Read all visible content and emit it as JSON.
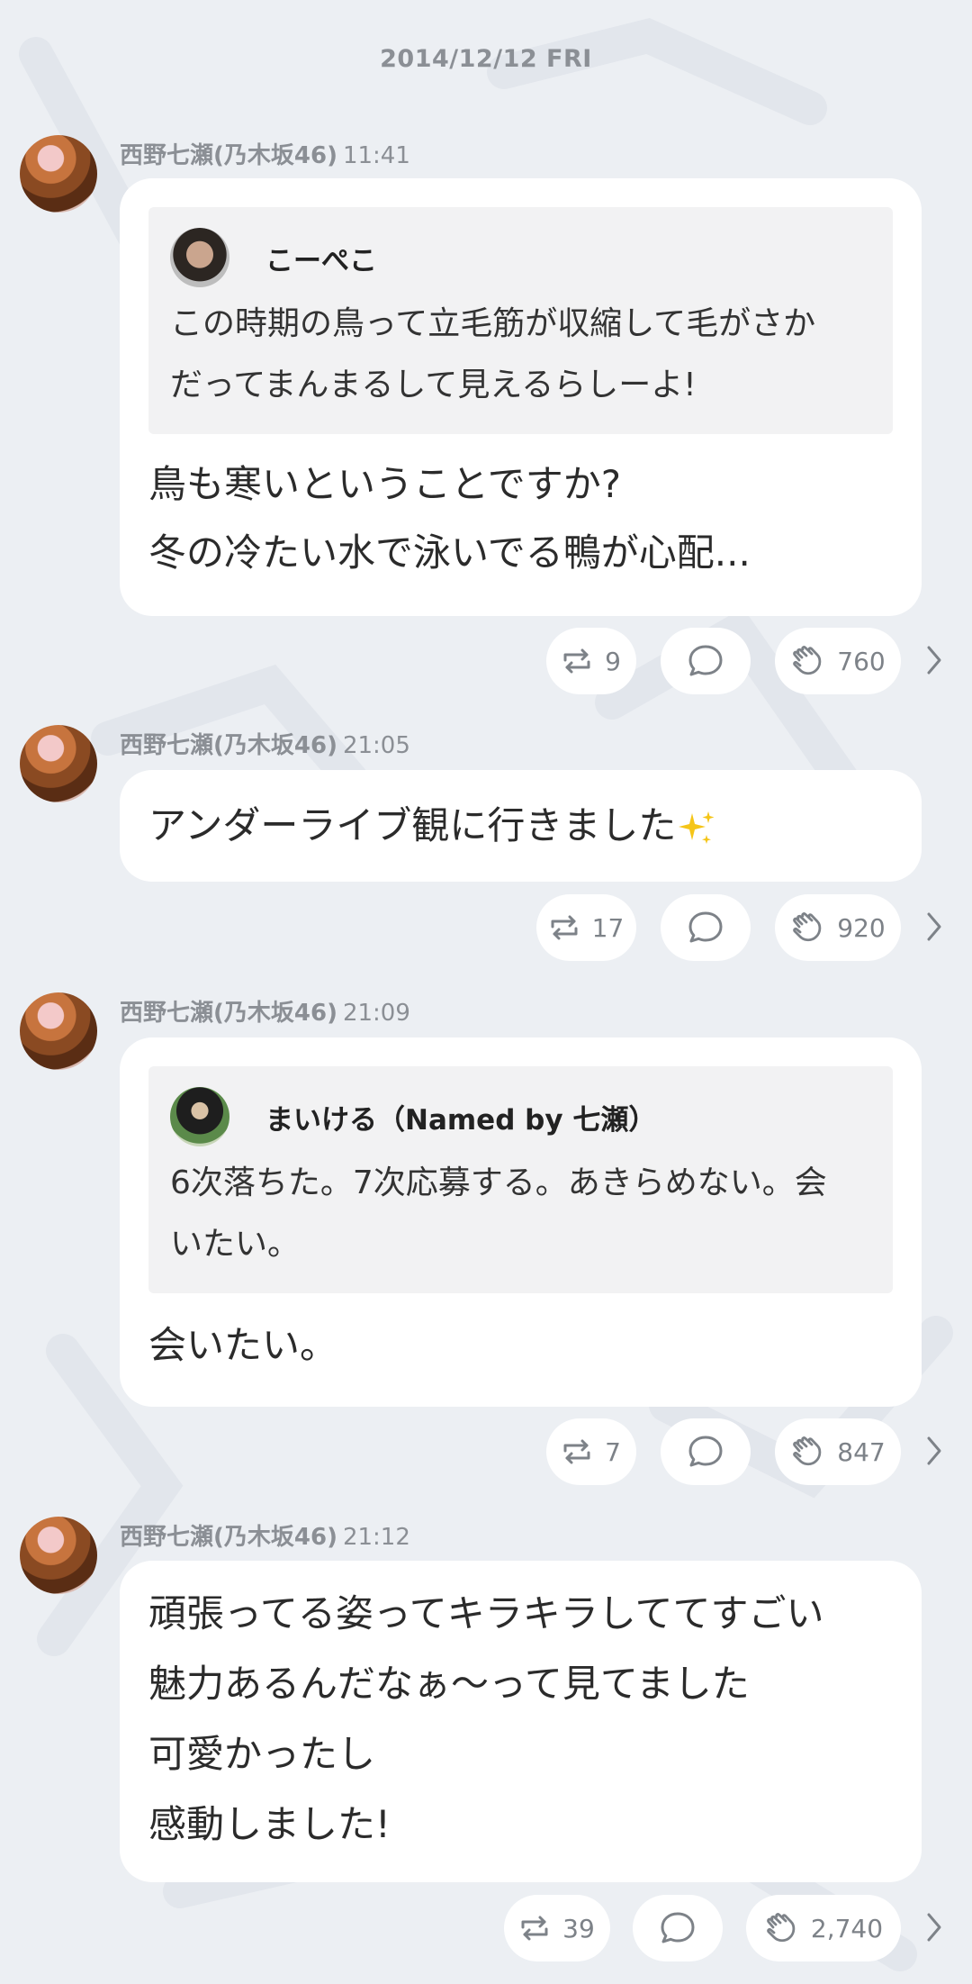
{
  "date_header": "2014/12/12 FRI",
  "posts": [
    {
      "author": "西野七瀬(乃木坂46)",
      "time": "11:41",
      "quote": {
        "name": "こーぺこ",
        "lines": [
          "この時期の鳥って立毛筋が収縮して毛がさか",
          "だってまんまるして見えるらしーよ!"
        ]
      },
      "lines": [
        "鳥も寒いということですか?",
        "冬の冷たい水で泳いでる鴨が心配..."
      ],
      "reposts": "9",
      "claps": "760"
    },
    {
      "author": "西野七瀬(乃木坂46)",
      "time": "21:05",
      "lines": [
        "アンダーライブ観に行きました"
      ],
      "reposts": "17",
      "claps": "920"
    },
    {
      "author": "西野七瀬(乃木坂46)",
      "time": "21:09",
      "quote": {
        "name": "まいける（Named by 七瀬）",
        "lines": [
          "6次落ちた。7次応募する。あきらめない。会",
          "いたい。"
        ]
      },
      "lines": [
        "会いたい。"
      ],
      "reposts": "7",
      "claps": "847"
    },
    {
      "author": "西野七瀬(乃木坂46)",
      "time": "21:12",
      "lines": [
        "頑張ってる姿ってキラキラしててすごい",
        "魅力あるんだなぁ〜って見てました",
        "可愛かったし",
        "感動しました!"
      ],
      "reposts": "39",
      "claps": "2,740"
    }
  ],
  "icons": {
    "repost": "repost-icon",
    "comment": "comment-icon",
    "clap": "clap-icon",
    "more": "chevron-right-icon",
    "sparkle": "sparkles-icon"
  },
  "colors": {
    "background": "#eceff3",
    "bubble": "#ffffff",
    "quote_bg": "#f2f2f3",
    "meta_text": "#8b8f95",
    "icon": "#7d8288"
  }
}
